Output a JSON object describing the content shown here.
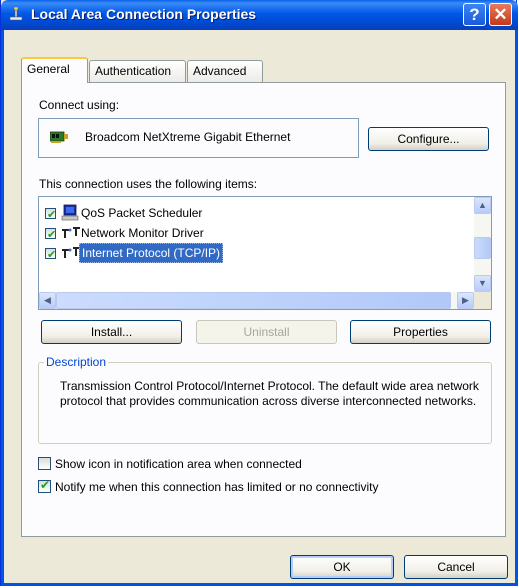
{
  "window": {
    "title": "Local Area Connection Properties",
    "help_glyph": "?",
    "close_glyph": "✕"
  },
  "tabs": [
    {
      "label": "General",
      "active": true
    },
    {
      "label": "Authentication",
      "active": false
    },
    {
      "label": "Advanced",
      "active": false
    }
  ],
  "general": {
    "connect_using_label": "Connect using:",
    "adapter_name": "Broadcom NetXtreme Gigabit Ethernet",
    "configure_label": "Configure...",
    "items_label": "This connection uses the following items:",
    "items": [
      {
        "label": "QoS Packet Scheduler",
        "checked": true,
        "icon": "scheduler-icon"
      },
      {
        "label": "Network Monitor Driver",
        "checked": true,
        "icon": "network-protocol-icon"
      },
      {
        "label": "Internet Protocol (TCP/IP)",
        "checked": true,
        "icon": "network-protocol-icon",
        "selected": true
      }
    ],
    "install_label": "Install...",
    "uninstall_label": "Uninstall",
    "properties_label": "Properties",
    "description_legend": "Description",
    "description_text": "Transmission Control Protocol/Internet Protocol. The default wide area network protocol that provides communication across diverse interconnected networks.",
    "show_icon_label": "Show icon in notification area when connected",
    "show_icon_checked": false,
    "notify_label": "Notify me when this connection has limited or no connectivity",
    "notify_checked": true
  },
  "footer": {
    "ok_label": "OK",
    "cancel_label": "Cancel"
  },
  "colors": {
    "title_bar": "#0058e6",
    "selection": "#316ac5",
    "dialog_bg": "#ece9d8",
    "group_legend": "#0046d5",
    "checkmark": "#21a121"
  }
}
